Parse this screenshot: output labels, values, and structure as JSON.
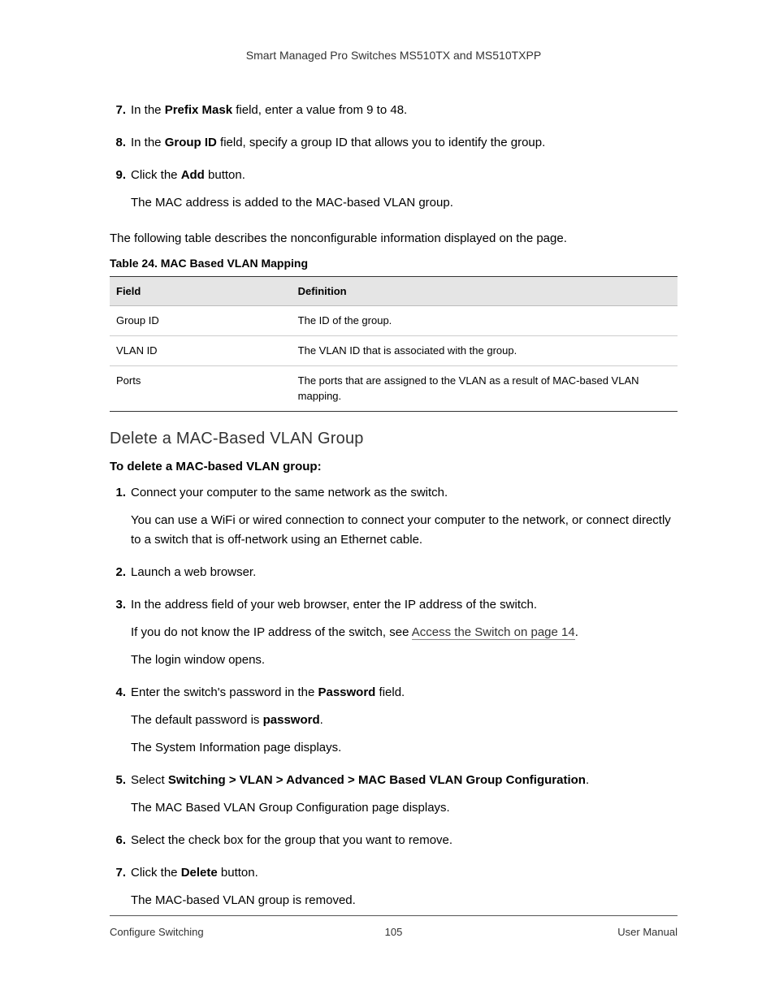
{
  "header": {
    "title": "Smart Managed Pro Switches MS510TX and MS510TXPP"
  },
  "stepsA": [
    {
      "num": "7.",
      "lead": "In the ",
      "bold": "Prefix Mask",
      "tail": " field, enter a value from 9 to 48."
    },
    {
      "num": "8.",
      "lead": "In the ",
      "bold": "Group ID",
      "tail": " field, specify a group ID that allows you to identify the group."
    },
    {
      "num": "9.",
      "lead": "Click the ",
      "bold": "Add",
      "tail": " button.",
      "after": "The MAC address is added to the MAC-based VLAN group."
    }
  ],
  "intro": "The following table describes the nonconfigurable information displayed on the page.",
  "table": {
    "caption": "Table 24.  MAC Based VLAN Mapping",
    "head": {
      "c1": "Field",
      "c2": "Definition"
    },
    "rows": [
      {
        "c1": "Group ID",
        "c2": "The ID of the group."
      },
      {
        "c1": "VLAN ID",
        "c2": "The VLAN ID that is associated with the group."
      },
      {
        "c1": "Ports",
        "c2": "The ports that are assigned to the VLAN as a result of MAC-based VLAN mapping."
      }
    ]
  },
  "section_heading": "Delete a MAC-Based VLAN Group",
  "proc_intro": "To delete a MAC-based VLAN group:",
  "stepsB": {
    "s1": {
      "num": "1.",
      "line": "Connect your computer to the same network as the switch.",
      "after": "You can use a WiFi or wired connection to connect your computer to the network, or connect directly to a switch that is off-network using an Ethernet cable."
    },
    "s2": {
      "num": "2.",
      "line": "Launch a web browser."
    },
    "s3": {
      "num": "3.",
      "line": "In the address field of your web browser, enter the IP address of the switch.",
      "after1a": "If you do not know the IP address of the switch, see ",
      "xref": "Access the Switch on page 14",
      "after1b": ".",
      "after2": "The login window opens."
    },
    "s4": {
      "num": "4.",
      "lead": "Enter the switch's password in the ",
      "bold": "Password",
      "tail": " field.",
      "after1a": "The default password is ",
      "after1b": "password",
      "after1c": ".",
      "after2": "The System Information page displays."
    },
    "s5": {
      "num": "5.",
      "lead": "Select ",
      "bold": "Switching > VLAN > Advanced > MAC Based VLAN Group Configuration",
      "tail": ".",
      "after": "The MAC Based VLAN Group Configuration page displays."
    },
    "s6": {
      "num": "6.",
      "line": "Select the check box for the group that you want to remove."
    },
    "s7": {
      "num": "7.",
      "lead": "Click the ",
      "bold": "Delete",
      "tail": " button.",
      "after": "The MAC-based VLAN group is removed."
    }
  },
  "footer": {
    "left": "Configure Switching",
    "center": "105",
    "right": "User Manual"
  }
}
